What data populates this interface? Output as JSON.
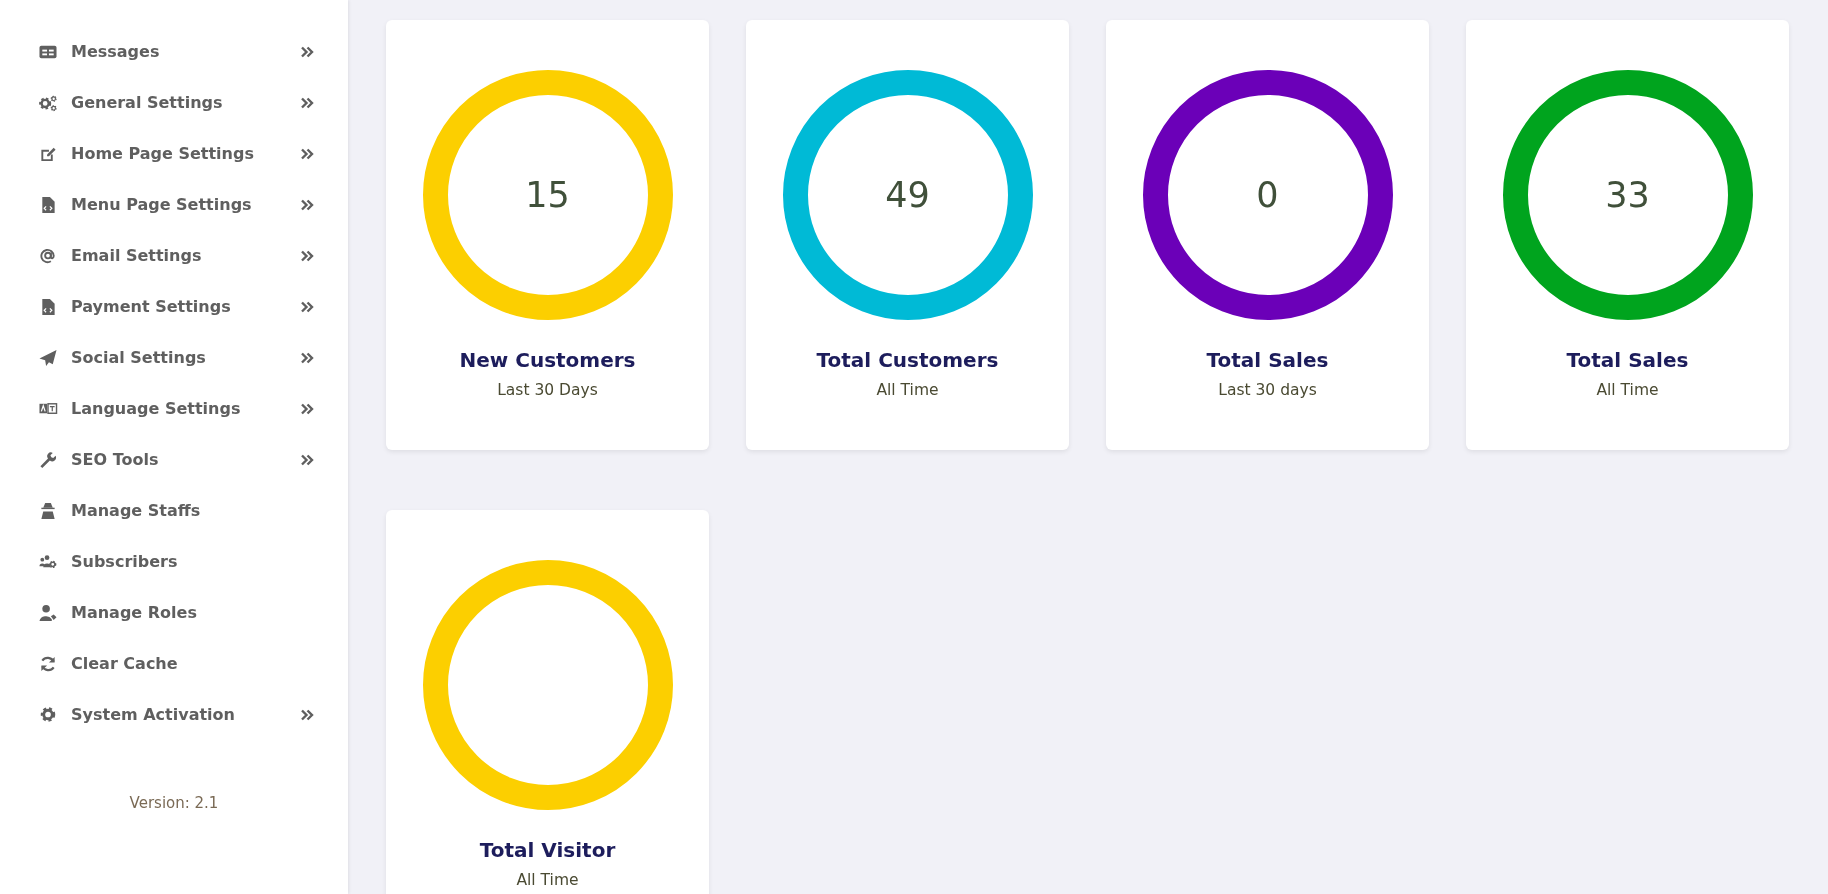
{
  "sidebar": {
    "items": [
      {
        "label": "Messages",
        "has_submenu": true
      },
      {
        "label": "General Settings",
        "has_submenu": true
      },
      {
        "label": "Home Page Settings",
        "has_submenu": true
      },
      {
        "label": "Menu Page Settings",
        "has_submenu": true
      },
      {
        "label": "Email Settings",
        "has_submenu": true
      },
      {
        "label": "Payment Settings",
        "has_submenu": true
      },
      {
        "label": "Social Settings",
        "has_submenu": true
      },
      {
        "label": "Language Settings",
        "has_submenu": true
      },
      {
        "label": "SEO Tools",
        "has_submenu": true
      },
      {
        "label": "Manage Staffs",
        "has_submenu": false
      },
      {
        "label": "Subscribers",
        "has_submenu": false
      },
      {
        "label": "Manage Roles",
        "has_submenu": false
      },
      {
        "label": "Clear Cache",
        "has_submenu": false
      },
      {
        "label": "System Activation",
        "has_submenu": true
      }
    ],
    "version": "Version: 2.1"
  },
  "cards": [
    {
      "value": "15",
      "title": "New Customers",
      "subtitle": "Last 30 Days",
      "color": "#fccf00"
    },
    {
      "value": "49",
      "title": "Total Customers",
      "subtitle": "All Time",
      "color": "#00bad6"
    },
    {
      "value": "0",
      "title": "Total Sales",
      "subtitle": "Last 30 days",
      "color": "#6b00b8"
    },
    {
      "value": "33",
      "title": "Total Sales",
      "subtitle": "All Time",
      "color": "#00a41e"
    },
    {
      "title": "Total Visitor",
      "subtitle": "All Time",
      "color": "#fccf00"
    }
  ]
}
